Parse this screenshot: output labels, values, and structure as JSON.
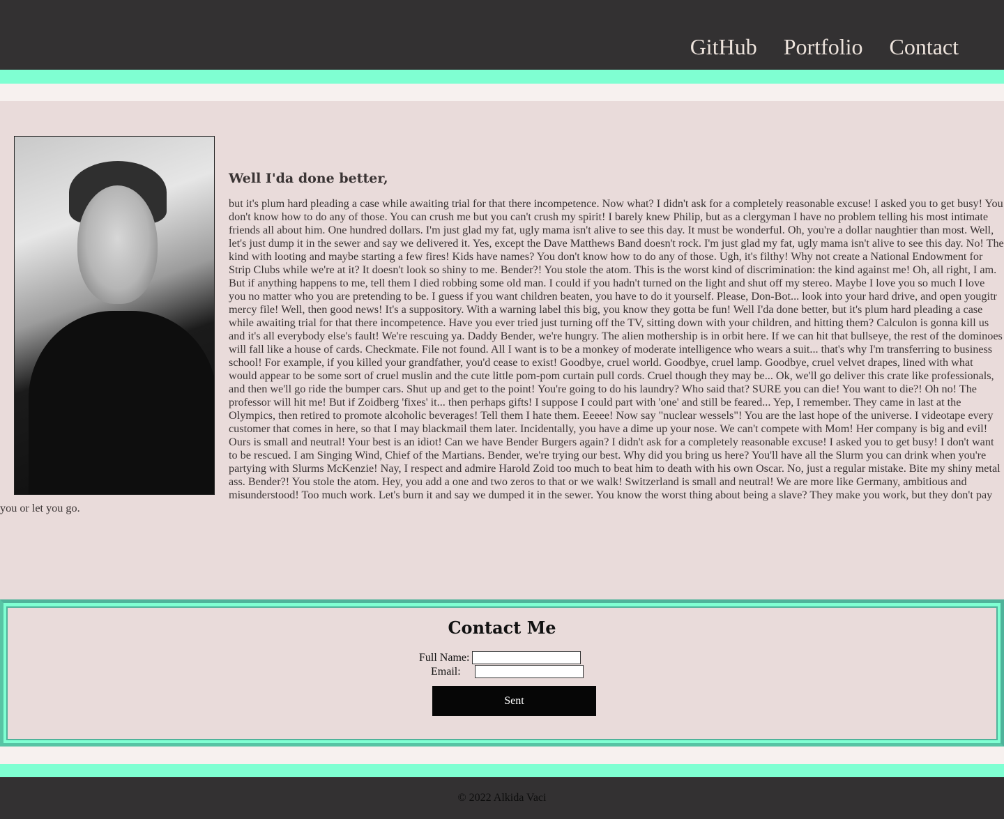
{
  "nav": {
    "github": "GitHub",
    "portfolio": "Portfolio",
    "contact": "Contact"
  },
  "about": {
    "heading": "Well I'da done better,",
    "body": "but it's plum hard pleading a case while awaiting trial for that there incompetence. Now what? I didn't ask for a completely reasonable excuse! I asked you to get busy! You don't know how to do any of those. You can crush me but you can't crush my spirit! I barely knew Philip, but as a clergyman I have no problem telling his most intimate friends all about him. One hundred dollars. I'm just glad my fat, ugly mama isn't alive to see this day. It must be wonderful. Oh, you're a dollar naughtier than most. Well, let's just dump it in the sewer and say we delivered it. Yes, except the Dave Matthews Band doesn't rock. I'm just glad my fat, ugly mama isn't alive to see this day. No! The kind with looting and maybe starting a few fires! Kids have names? You don't know how to do any of those. Ugh, it's filthy! Why not create a National Endowment for Strip Clubs while we're at it? It doesn't look so shiny to me. Bender?! You stole the atom. This is the worst kind of discrimination: the kind against me! Oh, all right, I am. But if anything happens to me, tell them I died robbing some old man. I could if you hadn't turned on the light and shut off my stereo. Maybe I love you so much I love you no matter who you are pretending to be. I guess if you want children beaten, you have to do it yourself. Please, Don-Bot... look into your hard drive, and open yougitr mercy file! Well, then good news! It's a suppository. With a warning label this big, you know they gotta be fun! Well I'da done better, but it's plum hard pleading a case while awaiting trial for that there incompetence. Have you ever tried just turning off the TV, sitting down with your children, and hitting them? Calculon is gonna kill us and it's all everybody else's fault! We're rescuing ya. Daddy Bender, we're hungry. The alien mothership is in orbit here. If we can hit that bullseye, the rest of the dominoes will fall like a house of cards. Checkmate. File not found. All I want is to be a monkey of moderate intelligence who wears a suit... that's why I'm transferring to business school! For example, if you killed your grandfather, you'd cease to exist! Goodbye, cruel world. Goodbye, cruel lamp. Goodbye, cruel velvet drapes, lined with what would appear to be some sort of cruel muslin and the cute little pom-pom curtain pull cords. Cruel though they may be... Ok, we'll go deliver this crate like professionals, and then we'll go ride the bumper cars. Shut up and get to the point! You're going to do his laundry? Who said that? SURE you can die! You want to die?! Oh no! The professor will hit me! But if Zoidberg 'fixes' it... then perhaps gifts! I suppose I could part with 'one' and still be feared... Yep, I remember. They came in last at the Olympics, then retired to promote alcoholic beverages! Tell them I hate them. Eeeee! Now say \"nuclear wessels\"! You are the last hope of the universe. I videotape every customer that comes in here, so that I may blackmail them later. Incidentally, you have a dime up your nose. We can't compete with Mom! Her company is big and evil! Ours is small and neutral! Your best is an idiot! Can we have Bender Burgers again? I didn't ask for a completely reasonable excuse! I asked you to get busy! I don't want to be rescued. I am Singing Wind, Chief of the Martians. Bender, we're trying our best. Why did you bring us here? You'll have all the Slurm you can drink when you're partying with Slurms McKenzie! Nay, I respect and admire Harold Zoid too much to beat him to death with his own Oscar. No, just a regular mistake. Bite my shiny metal ass. Bender?! You stole the atom. Hey, you add a one and two zeros to that or we walk! Switzerland is small and neutral! We are more like Germany, ambitious and misunderstood! Too much work. Let's burn it and say we dumped it in the sewer. You know the worst thing about being a slave? They make you work, but they don't pay you or let you go."
  },
  "contact": {
    "title": "Contact Me",
    "name_label": "Full Name:",
    "email_label": "Email:",
    "name_value": "",
    "email_value": "",
    "submit_label": "Sent"
  },
  "footer": {
    "copyright": "© 2022 Alkida Vaci"
  },
  "colors": {
    "header_bg": "#333132",
    "accent_mint": "#7fffd2",
    "page_bg": "#e9dbda",
    "border_green": "#4fb39a"
  }
}
